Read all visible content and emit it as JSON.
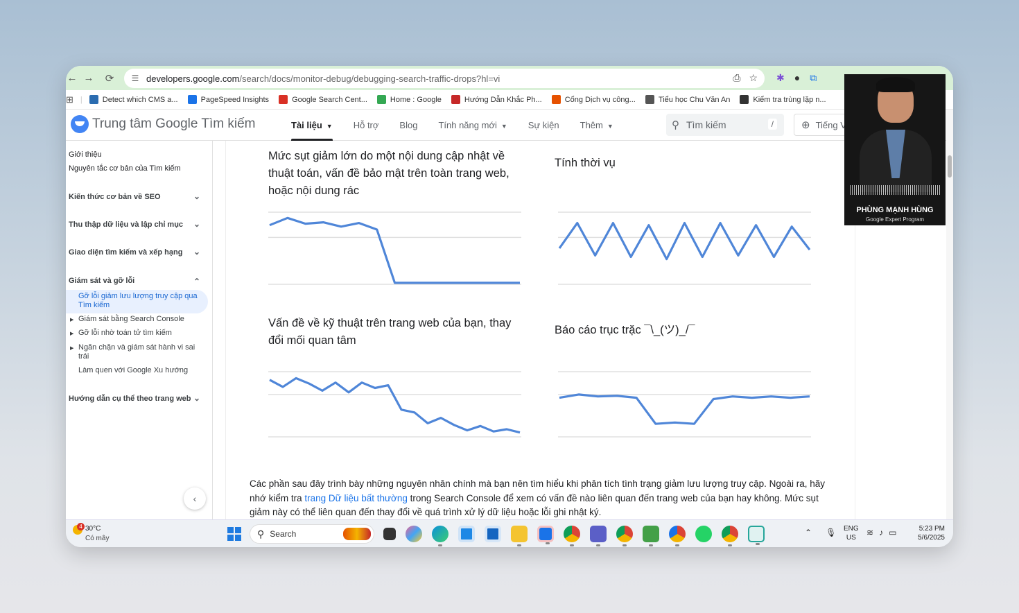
{
  "browser": {
    "url_host": "developers.google.com",
    "url_path": "/search/docs/monitor-debug/debugging-search-traffic-drops?hl=vi",
    "bookmarks": [
      {
        "label": "Detect which CMS a...",
        "color": "#2b6cb0"
      },
      {
        "label": "PageSpeed Insights",
        "color": "#1a73e8"
      },
      {
        "label": "Google Search Cent...",
        "color": "#d93025"
      },
      {
        "label": "Home : Google",
        "color": "#34a853"
      },
      {
        "label": "Hướng Dẫn Khắc Ph...",
        "color": "#c62828"
      },
      {
        "label": "Cổng Dịch vụ công...",
        "color": "#e65100"
      },
      {
        "label": "Tiểu học Chu Văn An",
        "color": "#555555"
      },
      {
        "label": "Kiểm tra trùng lặp n...",
        "color": "#333333"
      }
    ]
  },
  "site": {
    "title": "Trung tâm Google Tìm kiếm",
    "nav": [
      {
        "label": "Tài liệu",
        "active": true,
        "caret": true
      },
      {
        "label": "Hỗ trợ",
        "active": false,
        "caret": false
      },
      {
        "label": "Blog",
        "active": false,
        "caret": false
      },
      {
        "label": "Tính năng mới",
        "active": false,
        "caret": true
      },
      {
        "label": "Sự kiện",
        "active": false,
        "caret": false
      },
      {
        "label": "Thêm",
        "active": false,
        "caret": true
      }
    ],
    "search_placeholder": "Tìm kiếm",
    "search_shortcut": "/",
    "language_label": "Tiếng V"
  },
  "sidebar": {
    "top_links": [
      "Giới thiệu",
      "Nguyên tắc cơ bản của Tìm kiếm"
    ],
    "sections": [
      "Kiến thức cơ bản về SEO",
      "Thu thập dữ liệu và lập chỉ mục",
      "Giao diện tìm kiếm và xếp hạng",
      "Giám sát và gỡ lỗi"
    ],
    "active_item": "Gỡ lỗi giảm lưu lượng truy cập qua Tìm kiếm",
    "sub_items": [
      "Giám sát bằng Search Console",
      "Gỡ lỗi nhờ toán tử tìm kiếm",
      "Ngăn chặn và giám sát hành vi sai trái",
      "Làm quen với Google Xu hướng"
    ],
    "last_section": "Hướng dẫn cụ thể theo trang web"
  },
  "charts": {
    "c1_title": "Mức sụt giảm lớn do một nội dung cập nhật về thuật toán, vấn đề bảo mật trên toàn trang web, hoặc nội dung rác",
    "c2_title": "Tính thời vụ",
    "c3_title": "Vấn đề về kỹ thuật trên trang web của bạn, thay đổi mối quan tâm",
    "c4_title": "Báo cáo trục trặc ¯\\_(ツ)_/¯"
  },
  "chart_data": [
    {
      "type": "line",
      "title": "Mức sụt giảm lớn do một nội dung cập nhật về thuật toán, vấn đề bảo mật trên toàn trang web, hoặc nội dung rác",
      "values": [
        82,
        92,
        84,
        86,
        80,
        85,
        76,
        2,
        2,
        2,
        2,
        2,
        2,
        2,
        2
      ],
      "ylim": [
        0,
        100
      ]
    },
    {
      "type": "line",
      "title": "Tính thời vụ",
      "values": [
        50,
        85,
        40,
        85,
        38,
        82,
        35,
        85,
        38,
        85,
        40,
        82,
        38,
        80,
        48
      ],
      "ylim": [
        0,
        100
      ]
    },
    {
      "type": "line",
      "title": "Vấn đề về kỹ thuật trên trang web của bạn, thay đổi mối quan tâm",
      "values": [
        85,
        72,
        88,
        78,
        65,
        80,
        62,
        80,
        70,
        75,
        30,
        25,
        5,
        15,
        2,
        -8,
        0,
        -10,
        -6,
        -12
      ],
      "ylim": [
        -20,
        100
      ]
    },
    {
      "type": "line",
      "title": "Báo cáo trục trặc ¯\\_(ツ)_/¯",
      "values": [
        60,
        65,
        62,
        63,
        60,
        20,
        22,
        20,
        58,
        62,
        60,
        62,
        60,
        62
      ],
      "ylim": [
        0,
        100
      ]
    }
  ],
  "paragraph": {
    "before_link": "Các phần sau đây trình bày những nguyên nhân chính mà bạn nên tìm hiểu khi phân tích tình trạng giảm lưu lượng truy cập. Ngoài ra, hãy nhớ kiểm tra ",
    "link": "trang Dữ liệu bất thường",
    "after_link": " trong Search Console để xem có vấn đề nào liên quan đến trang web của bạn hay không. Mức sụt giảm này có thể liên quan đến thay đổi về quá trình xử lý dữ liệu hoặc lỗi ghi nhật ký."
  },
  "webcam": {
    "name": "PHÙNG MẠNH HÙNG",
    "role": "Google Expert Program"
  },
  "taskbar": {
    "temperature": "30°C",
    "weather": "Có mây",
    "weather_badge": "4",
    "search_label": "Search",
    "lang_line1": "ENG",
    "lang_line2": "US",
    "time": "5:23 PM",
    "date": "5/6/2025"
  }
}
